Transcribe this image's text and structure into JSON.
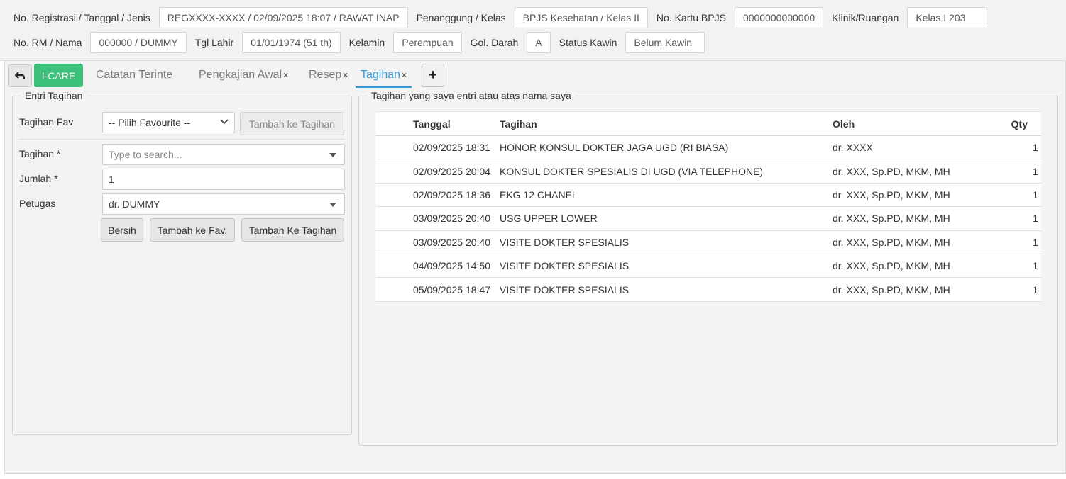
{
  "header": {
    "row1": [
      {
        "label": "No. Registrasi / Tanggal / Jenis",
        "value": "REGXXXX-XXXX / 02/09/2025 18:07 / RAWAT INAP"
      },
      {
        "label": "Penanggung / Kelas",
        "value": "BPJS Kesehatan / Kelas II"
      },
      {
        "label": "No. Kartu BPJS",
        "value": "0000000000000"
      },
      {
        "label": "Klinik/Ruangan",
        "value": "Kelas I 203"
      }
    ],
    "row2": [
      {
        "label": "No. RM / Nama",
        "value": "000000 / DUMMY"
      },
      {
        "label": "Tgl Lahir",
        "value": "01/01/1974 (51 th)"
      },
      {
        "label": "Kelamin",
        "value": "Perempuan"
      },
      {
        "label": "Gol. Darah",
        "value": "A"
      },
      {
        "label": "Status Kawin",
        "value": "Belum Kawin"
      }
    ]
  },
  "tabs": {
    "back_icon": "undo-arrow-icon",
    "icare_label": "I-CARE",
    "items": [
      {
        "label": "Catatan Terinte",
        "closable": false
      },
      {
        "label": "Pengkajian Awal",
        "closable": true
      },
      {
        "label": "Resep",
        "closable": true
      },
      {
        "label": "Tagihan",
        "closable": true,
        "active": true
      }
    ],
    "close_glyph": "×",
    "add_glyph": "+",
    "accent_color": "#3a9bd8"
  },
  "entry": {
    "legend": "Entri Tagihan",
    "fav_label": "Tagihan Fav",
    "fav_select": "-- Pilih Favourite --",
    "fav_add_button": "Tambah ke Tagihan",
    "tagihan_label": "Tagihan *",
    "tagihan_placeholder": "Type to search...",
    "jumlah_label": "Jumlah *",
    "jumlah_value": "1",
    "petugas_label": "Petugas",
    "petugas_value": "dr. DUMMY",
    "btn_clear": "Bersih",
    "btn_add_fav": "Tambah ke Fav.",
    "btn_add_bill": "Tambah Ke Tagihan"
  },
  "list": {
    "legend": "Tagihan yang saya entri atau atas nama saya",
    "columns": [
      "Tanggal",
      "Tagihan",
      "Oleh",
      "Qty"
    ],
    "rows": [
      {
        "tanggal": "02/09/2025 18:31",
        "tagihan": "HONOR KONSUL DOKTER JAGA UGD (RI BIASA)",
        "oleh": "dr. XXXX",
        "qty": "1"
      },
      {
        "tanggal": "02/09/2025 20:04",
        "tagihan": "KONSUL DOKTER SPESIALIS DI UGD (VIA TELEPHONE)",
        "oleh": "dr. XXX, Sp.PD, MKM, MH",
        "qty": "1"
      },
      {
        "tanggal": "02/09/2025 18:36",
        "tagihan": "EKG 12 CHANEL",
        "oleh": "dr. XXX, Sp.PD, MKM, MH",
        "qty": "1"
      },
      {
        "tanggal": "03/09/2025 20:40",
        "tagihan": "USG UPPER LOWER",
        "oleh": "dr. XXX, Sp.PD, MKM, MH",
        "qty": "1"
      },
      {
        "tanggal": "03/09/2025 20:40",
        "tagihan": "VISITE DOKTER SPESIALIS",
        "oleh": "dr. XXX, Sp.PD, MKM, MH",
        "qty": "1"
      },
      {
        "tanggal": "04/09/2025 14:50",
        "tagihan": "VISITE DOKTER SPESIALIS",
        "oleh": "dr. XXX, Sp.PD, MKM, MH",
        "qty": "1"
      },
      {
        "tanggal": "05/09/2025 18:47",
        "tagihan": "VISITE DOKTER SPESIALIS",
        "oleh": "dr. XXX, Sp.PD, MKM, MH",
        "qty": "1"
      }
    ]
  }
}
